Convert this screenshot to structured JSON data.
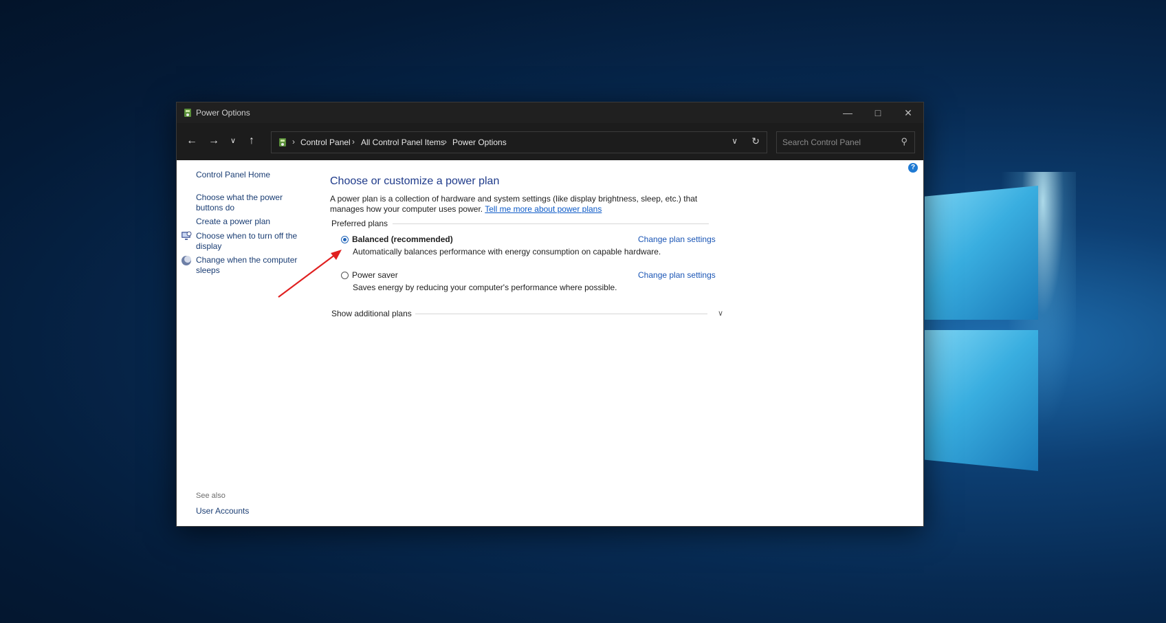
{
  "window": {
    "title": "Power Options"
  },
  "address_bar": {
    "crumbs": [
      "Control Panel",
      "All Control Panel Items",
      "Power Options"
    ]
  },
  "search": {
    "placeholder": "Search Control Panel"
  },
  "sidebar": {
    "home": "Control Panel Home",
    "items": [
      {
        "label": "Choose what the power buttons do",
        "icon": "none"
      },
      {
        "label": "Create a power plan",
        "icon": "none"
      },
      {
        "label": "Choose when to turn off the display",
        "icon": "monitor-icon"
      },
      {
        "label": "Change when the computer sleeps",
        "icon": "moon-icon"
      }
    ],
    "see_also_label": "See also",
    "see_also_items": [
      "User Accounts"
    ]
  },
  "main": {
    "title": "Choose or customize a power plan",
    "description": "A power plan is a collection of hardware and system settings (like display brightness, sleep, etc.) that manages how your computer uses power.",
    "more_link": "Tell me more about power plans",
    "preferred_label": "Preferred plans",
    "plans": [
      {
        "name": "Balanced (recommended)",
        "description": "Automatically balances performance with energy consumption on capable hardware.",
        "selected": true,
        "link": "Change plan settings"
      },
      {
        "name": "Power saver",
        "description": "Saves energy by reducing your computer's performance where possible.",
        "selected": false,
        "link": "Change plan settings"
      }
    ],
    "additional": "Show additional plans"
  },
  "colors": {
    "accent": "#1f63b8",
    "annotation_arrow": "#e02020"
  }
}
